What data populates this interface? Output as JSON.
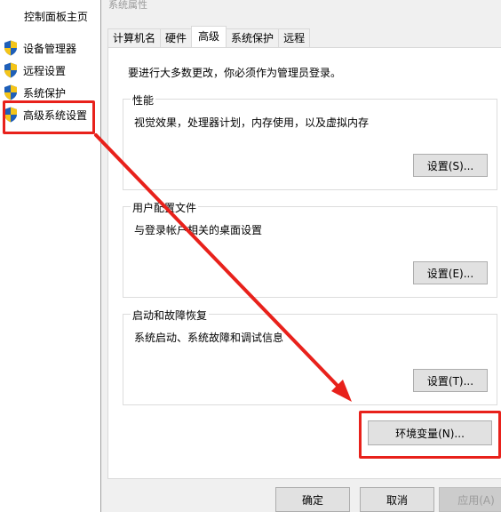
{
  "left_pane": {
    "home_link": "控制面板主页",
    "items": [
      {
        "label": "设备管理器",
        "icon": "uac-shield-icon"
      },
      {
        "label": "远程设置",
        "icon": "uac-shield-icon"
      },
      {
        "label": "系统保护",
        "icon": "uac-shield-icon"
      },
      {
        "label": "高级系统设置",
        "icon": "uac-shield-icon",
        "highlighted": true
      }
    ]
  },
  "dialog": {
    "title": "系统属性",
    "tabs": [
      {
        "label": "计算机名",
        "active": false
      },
      {
        "label": "硬件",
        "active": false
      },
      {
        "label": "高级",
        "active": true
      },
      {
        "label": "系统保护",
        "active": false
      },
      {
        "label": "远程",
        "active": false
      }
    ],
    "notice": "要进行大多数更改，你必须作为管理员登录。",
    "groups": {
      "performance": {
        "title": "性能",
        "desc": "视觉效果，处理器计划，内存使用，以及虚拟内存",
        "button": "设置(S)..."
      },
      "user_profiles": {
        "title": "用户配置文件",
        "desc": "与登录帐户相关的桌面设置",
        "button": "设置(E)..."
      },
      "startup_recovery": {
        "title": "启动和故障恢复",
        "desc": "系统启动、系统故障和调试信息",
        "button": "设置(T)..."
      }
    },
    "env_button": "环境变量(N)...",
    "footer": {
      "ok": "确定",
      "cancel": "取消",
      "apply": "应用(A)"
    }
  },
  "annotations": {
    "color": "#e8211b"
  }
}
